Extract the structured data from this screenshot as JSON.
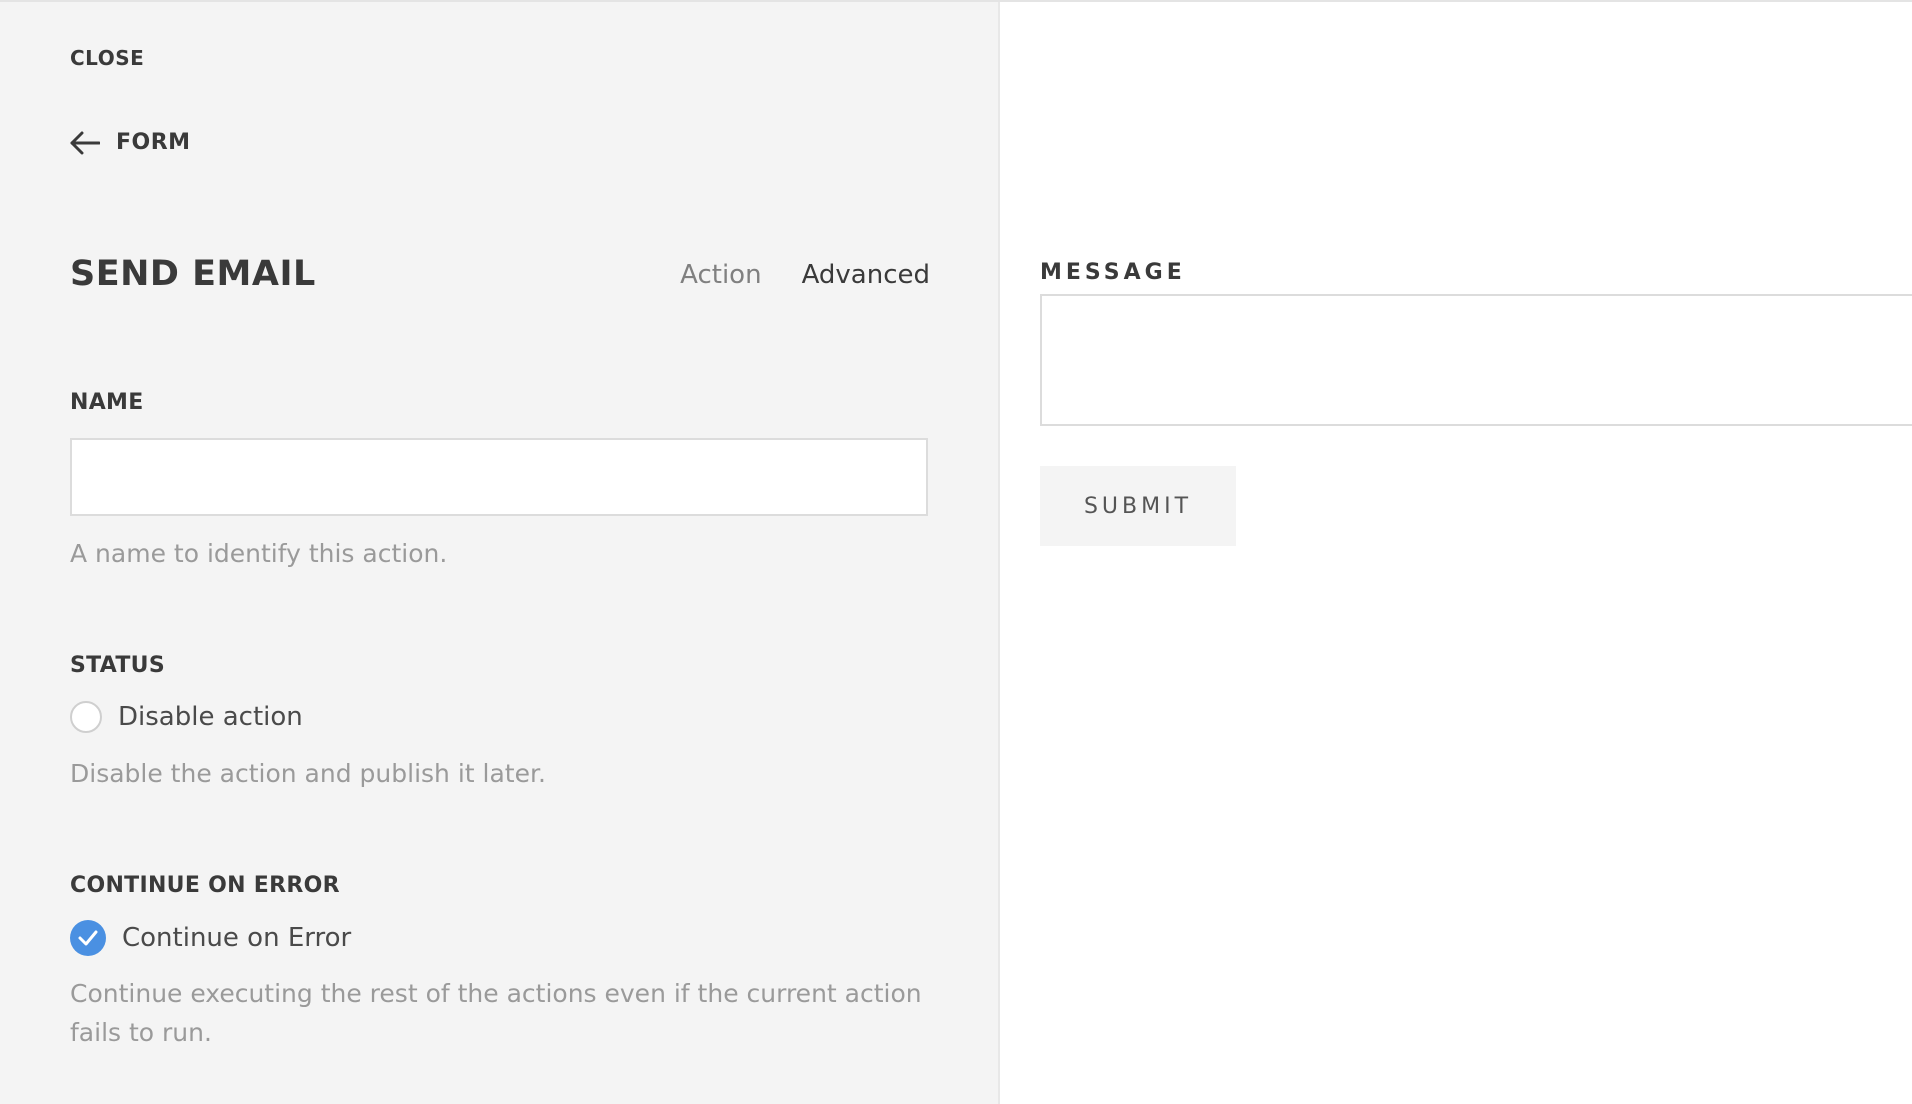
{
  "panel": {
    "close_label": "CLOSE",
    "back_label": "FORM",
    "title": "SEND EMAIL",
    "tabs": [
      {
        "label": "Action",
        "active": false
      },
      {
        "label": "Advanced",
        "active": true
      }
    ],
    "name_section": {
      "label": "NAME",
      "value": "",
      "help": "A name to identify this action."
    },
    "status_section": {
      "label": "STATUS",
      "option_label": "Disable action",
      "checked": false,
      "help": "Disable the action and publish it later."
    },
    "continue_section": {
      "label": "CONTINUE ON ERROR",
      "option_label": "Continue on Error",
      "checked": true,
      "help_line1": "Continue executing the rest of the actions even if the current action",
      "help_line2": "fails to run."
    }
  },
  "form_preview": {
    "message_label": "MESSAGE",
    "message_value": "",
    "submit_label": "SUBMIT"
  },
  "colors": {
    "panel_bg": "#f4f4f4",
    "accent": "#4a90e2",
    "text_dark": "#3a3a3a",
    "text_muted": "#9a9a9a"
  },
  "icons": {
    "back": "arrow-left-icon",
    "checked": "checkmark-icon"
  }
}
